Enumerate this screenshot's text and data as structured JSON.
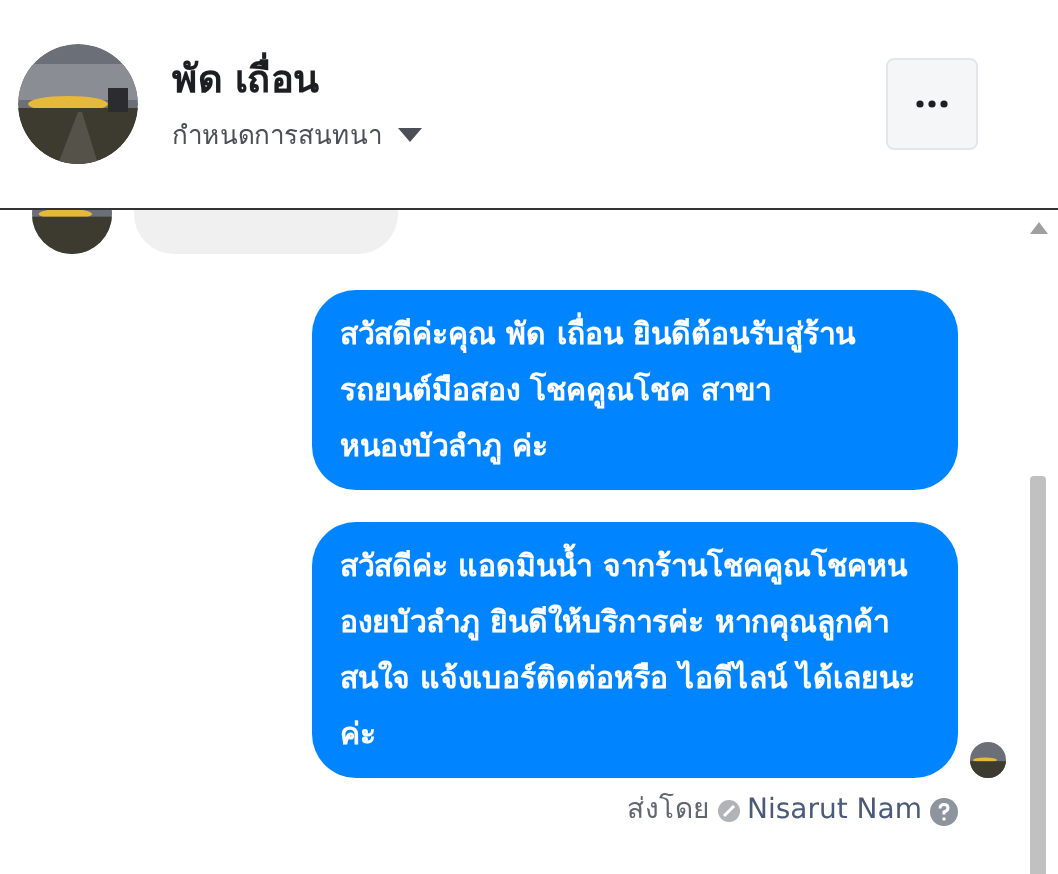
{
  "header": {
    "name": "พัด เถื่อน",
    "subtitle": "กำหนดการสนทนา"
  },
  "messages": [
    {
      "kind": "incoming"
    },
    {
      "kind": "outgoing",
      "text": "สวัสดีค่ะคุณ พัด เถื่อน ยินดีต้อนรับสู่ร้าน รถยนต์มือสอง โชคคูณโชค สาขาหนองบัวลำภู ค่ะ"
    },
    {
      "kind": "outgoing",
      "text": "สวัสดีค่ะ แอดมินน้ำ จากร้านโชคคูณโชคหนองยบัวลำภู ยินดีให้บริการค่ะ หากคุณลูกค้าสนใจ แจ้งเบอร์ติดต่อหรือ ไอดีไลน์ ได้เลยนะค่ะ",
      "seen": true
    }
  ],
  "sent_by": {
    "label": "ส่งโดย",
    "name": "Nisarut Nam"
  }
}
